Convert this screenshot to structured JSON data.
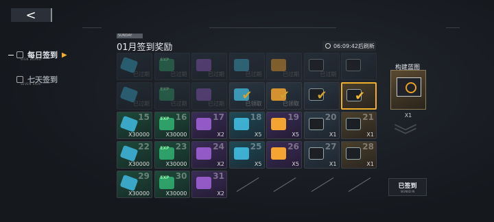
{
  "nav": {
    "back_glyph": "<"
  },
  "sidebar": [
    {
      "label": "每日签到",
      "sub": "SIGN BOARD",
      "active": true
    },
    {
      "label": "七天签到",
      "sub": "SEVEN SIGN",
      "active": false
    }
  ],
  "header": {
    "weekday": "SUNDAY",
    "title": "01月签到奖励",
    "refresh": "06:09:42后刷新"
  },
  "cells": [
    {
      "day": "",
      "icon": "ic-cube",
      "tone": "t-dark",
      "state": "faded",
      "qty": "已过期"
    },
    {
      "day": "",
      "icon": "ic-green",
      "tone": "t-dark",
      "state": "faded",
      "qty": "已过期",
      "exp": "EXP"
    },
    {
      "day": "",
      "icon": "ic-purple",
      "tone": "t-dark",
      "state": "faded",
      "qty": "已过期"
    },
    {
      "day": "",
      "icon": "ic-blue",
      "tone": "t-dark",
      "state": "faded",
      "qty": "已过期"
    },
    {
      "day": "",
      "icon": "ic-gold",
      "tone": "t-dark",
      "state": "faded",
      "qty": "已过期"
    },
    {
      "day": "",
      "icon": "ic-dark",
      "tone": "t-dark",
      "state": "faded",
      "qty": "已过期"
    },
    {
      "day": "",
      "icon": "ic-dark",
      "tone": "t-dark",
      "state": "faded",
      "qty": ""
    },
    {
      "day": "",
      "icon": "ic-cube",
      "tone": "t-dark",
      "state": "faded",
      "qty": "已过期"
    },
    {
      "day": "",
      "icon": "ic-green",
      "tone": "t-dark",
      "state": "faded",
      "qty": "已过期",
      "exp": "EXP"
    },
    {
      "day": "",
      "icon": "ic-purple",
      "tone": "t-dark",
      "state": "faded",
      "qty": "已过期"
    },
    {
      "day": "",
      "icon": "ic-blue",
      "tone": "t-dark",
      "state": "claimed",
      "qty": "已领取",
      "check": true
    },
    {
      "day": "",
      "icon": "ic-gold",
      "tone": "t-dark",
      "state": "claimed",
      "qty": "已领取",
      "check": true
    },
    {
      "day": "",
      "icon": "ic-dark",
      "tone": "t-dark",
      "state": "claimed",
      "qty": "",
      "check": true
    },
    {
      "day": "",
      "icon": "ic-dark",
      "tone": "t-gold",
      "state": "today",
      "qty": "",
      "check": true
    },
    {
      "day": "15",
      "icon": "ic-cube",
      "tone": "t-green",
      "state": "",
      "qty": "X30000"
    },
    {
      "day": "16",
      "icon": "ic-green",
      "tone": "t-green",
      "state": "",
      "qty": "X30000",
      "exp": "EXP"
    },
    {
      "day": "17",
      "icon": "ic-purple",
      "tone": "t-purple",
      "state": "",
      "qty": "X2"
    },
    {
      "day": "18",
      "icon": "ic-blue",
      "tone": "t-blue",
      "state": "",
      "qty": "X5"
    },
    {
      "day": "19",
      "icon": "ic-gold",
      "tone": "t-purple",
      "state": "",
      "qty": "X5"
    },
    {
      "day": "20",
      "icon": "ic-dark",
      "tone": "t-dark",
      "state": "",
      "qty": "X1"
    },
    {
      "day": "21",
      "icon": "ic-dark",
      "tone": "t-gold",
      "state": "",
      "qty": "X1"
    },
    {
      "day": "22",
      "icon": "ic-cube",
      "tone": "t-green",
      "state": "",
      "qty": "X30000"
    },
    {
      "day": "23",
      "icon": "ic-green",
      "tone": "t-green",
      "state": "",
      "qty": "X30000",
      "exp": "EXP"
    },
    {
      "day": "24",
      "icon": "ic-purple",
      "tone": "t-purple",
      "state": "",
      "qty": "X2"
    },
    {
      "day": "25",
      "icon": "ic-blue",
      "tone": "t-blue",
      "state": "",
      "qty": "X5"
    },
    {
      "day": "26",
      "icon": "ic-gold",
      "tone": "t-purple",
      "state": "",
      "qty": "X5"
    },
    {
      "day": "27",
      "icon": "ic-dark",
      "tone": "t-dark",
      "state": "",
      "qty": "X1"
    },
    {
      "day": "28",
      "icon": "ic-dark",
      "tone": "t-gold",
      "state": "",
      "qty": "X1"
    },
    {
      "day": "29",
      "icon": "ic-cube",
      "tone": "t-green",
      "state": "",
      "qty": "X30000"
    },
    {
      "day": "30",
      "icon": "ic-green",
      "tone": "t-green",
      "state": "",
      "qty": "X30000",
      "exp": "EXP"
    },
    {
      "day": "31",
      "icon": "ic-purple",
      "tone": "t-purple",
      "state": "",
      "qty": "X2"
    },
    {
      "empty": true
    },
    {
      "empty": true
    },
    {
      "empty": true
    },
    {
      "empty": true
    }
  ],
  "blueprint": {
    "title": "构建蓝图",
    "qty": "X1"
  },
  "signed": {
    "label": "已签到",
    "sub": "SIGNED IN"
  }
}
